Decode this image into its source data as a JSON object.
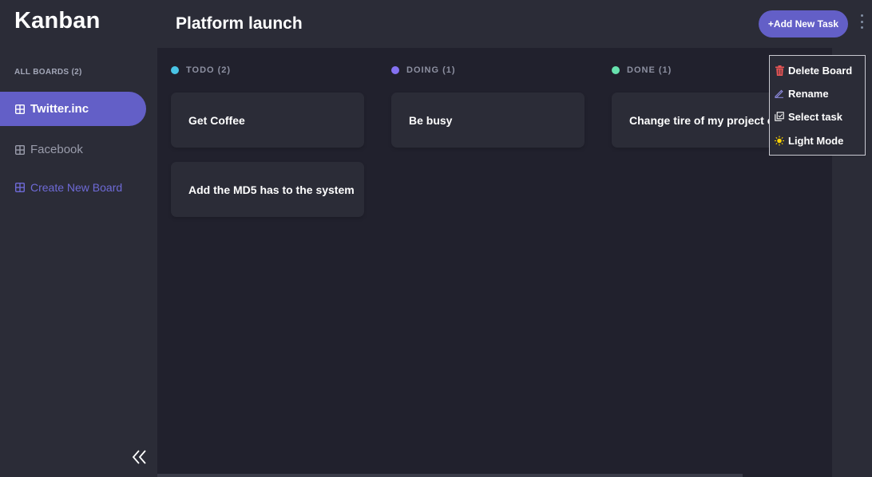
{
  "app": {
    "logo": "Kanban"
  },
  "sidebar": {
    "heading": "ALL BOARDS (2)",
    "boards": [
      {
        "label": "Twitter.inc",
        "active": true
      },
      {
        "label": "Facebook",
        "active": false
      }
    ],
    "create_label": "Create New Board",
    "collapse_icon": "double-chevron-left-icon"
  },
  "header": {
    "title": "Platform launch",
    "add_task_label": "+Add New Task",
    "menu_icon": "kebab-icon"
  },
  "columns": [
    {
      "label": "TODO (2)",
      "color": "#49c4e5",
      "cards": [
        "Get Coffee",
        "Add the MD5 has to the system"
      ]
    },
    {
      "label": "DOING (1)",
      "color": "#8471f2",
      "cards": [
        "Be busy"
      ]
    },
    {
      "label": "DONE (1)",
      "color": "#67e2ae",
      "cards": [
        "Change tire of my project car"
      ]
    }
  ],
  "menu": {
    "items": [
      {
        "label": "Delete Board",
        "icon": "trash-icon"
      },
      {
        "label": "Rename",
        "icon": "pencil-icon"
      },
      {
        "label": "Select task",
        "icon": "select-icon"
      },
      {
        "label": "Light Mode",
        "icon": "sun-icon"
      }
    ]
  },
  "colors": {
    "accent": "#635fc7",
    "sidebar_bg": "#2b2c37",
    "board_bg": "#20212c",
    "trash": "#ea5555",
    "sun": "#ffd400"
  }
}
